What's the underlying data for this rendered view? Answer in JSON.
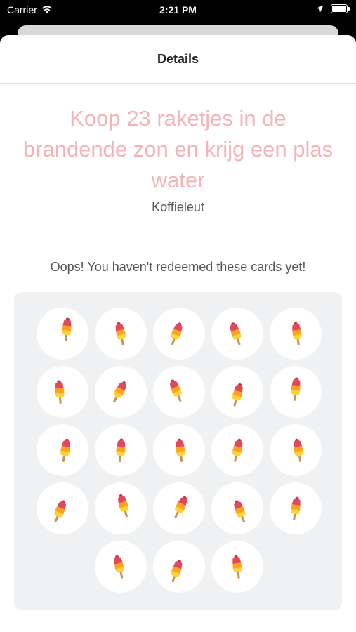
{
  "status_bar": {
    "carrier": "Carrier",
    "time": "2:21 PM"
  },
  "nav": {
    "title": "Details"
  },
  "card": {
    "title": "Koop 23 raketjes in de brandende zon en krijg een plas water",
    "shop": "Koffieleut",
    "message": "Oops! You haven't redeemed these cards yet!",
    "stamps_total": 23,
    "stamp_icon": "popsicle-icon",
    "colors": {
      "title": "#f6b3b7",
      "grid_bg": "#f0f1f2"
    }
  }
}
